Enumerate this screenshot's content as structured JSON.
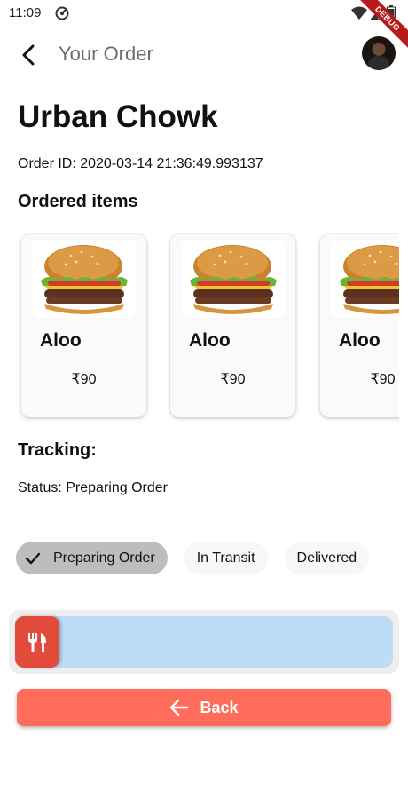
{
  "status_bar": {
    "time": "11:09"
  },
  "debug_banner": "DEBUG",
  "appbar": {
    "title": "Your Order"
  },
  "order": {
    "restaurant": "Urban Chowk",
    "order_id_text": "Order ID: 2020-03-14 21:36:49.993137"
  },
  "ordered_items": {
    "title": "Ordered items",
    "items": [
      {
        "name": "Aloo",
        "price": "₹90"
      },
      {
        "name": "Aloo",
        "price": "₹90"
      },
      {
        "name": "Aloo",
        "price": "₹90"
      }
    ]
  },
  "tracking": {
    "title": "Tracking:",
    "status_text": "Status: Preparing Order",
    "chips": [
      {
        "label": "Preparing Order",
        "selected": true
      },
      {
        "label": "In Transit",
        "selected": false
      },
      {
        "label": "Delivered",
        "selected": false
      }
    ],
    "slider": {
      "icon": "restaurant-icon",
      "progress": 0.0
    }
  },
  "back_button": {
    "label": "Back",
    "icon": "arrow-left-icon"
  },
  "colors": {
    "slider_thumb": "#e24a3b",
    "slider_track": "#bcdcf8",
    "back_button": "#ff6c5c",
    "chip_selected": "#bdbdbd"
  }
}
